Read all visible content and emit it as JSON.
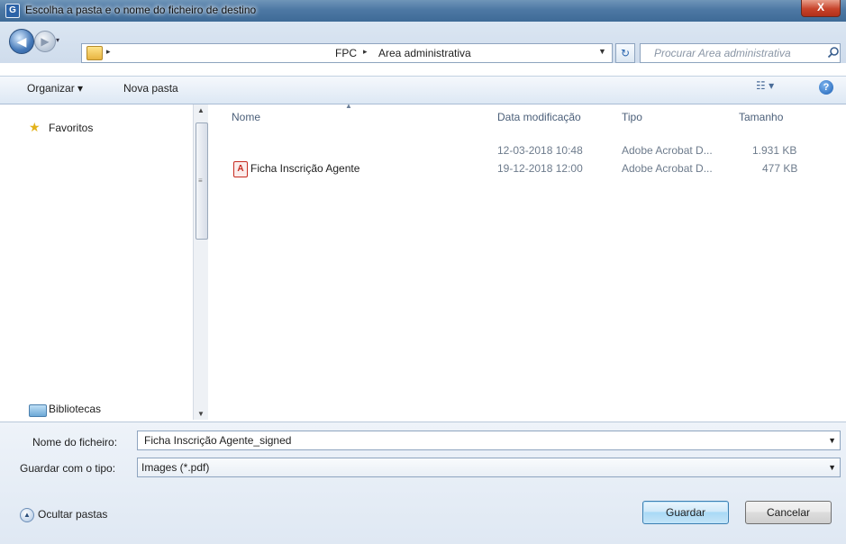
{
  "window": {
    "title": "Escolha a pasta e o nome do ficheiro de destino",
    "close_label": "X",
    "app_icon_letter": "G"
  },
  "address": {
    "crumbs": [
      "FPC",
      "Area administrativa"
    ],
    "crumb_separator": "▸",
    "search_placeholder": "Procurar Area administrativa"
  },
  "toolbar": {
    "organize": "Organizar ▾",
    "new_folder": "Nova pasta",
    "view": "☷ ▾",
    "help": "?"
  },
  "nav": {
    "favorites": "Favoritos",
    "libraries": "Bibliotecas"
  },
  "file_list": {
    "columns": [
      "Nome",
      "Data modificação",
      "Tipo",
      "Tamanho"
    ],
    "rows": [
      {
        "name": "",
        "date": "12-03-2018 10:48",
        "type": "Adobe Acrobat D...",
        "size": "1.931 KB"
      },
      {
        "name": "Ficha Inscrição Agente",
        "date": "19-12-2018 12:00",
        "type": "Adobe Acrobat D...",
        "size": "477 KB"
      }
    ]
  },
  "form": {
    "filename_label": "Nome do ficheiro:",
    "filename_value": "Ficha Inscrição Agente_signed",
    "type_label": "Guardar com o tipo:",
    "type_value": "Images (*.pdf)"
  },
  "footer": {
    "hide_folders": "Ocultar pastas",
    "save": "Guardar",
    "cancel": "Cancelar"
  },
  "icons": {
    "back": "arrow-left-icon",
    "forward": "arrow-right-icon",
    "refresh": "refresh-icon",
    "search": "search-icon",
    "help": "help-icon",
    "favorites": "star-icon",
    "libraries": "library-icon",
    "pdf": "pdf-file-icon"
  },
  "colors": {
    "titlebar": "#4d78a4",
    "close": "#c7432a",
    "pdf": "#c62b20",
    "primary_button": "#a9d9f6"
  }
}
